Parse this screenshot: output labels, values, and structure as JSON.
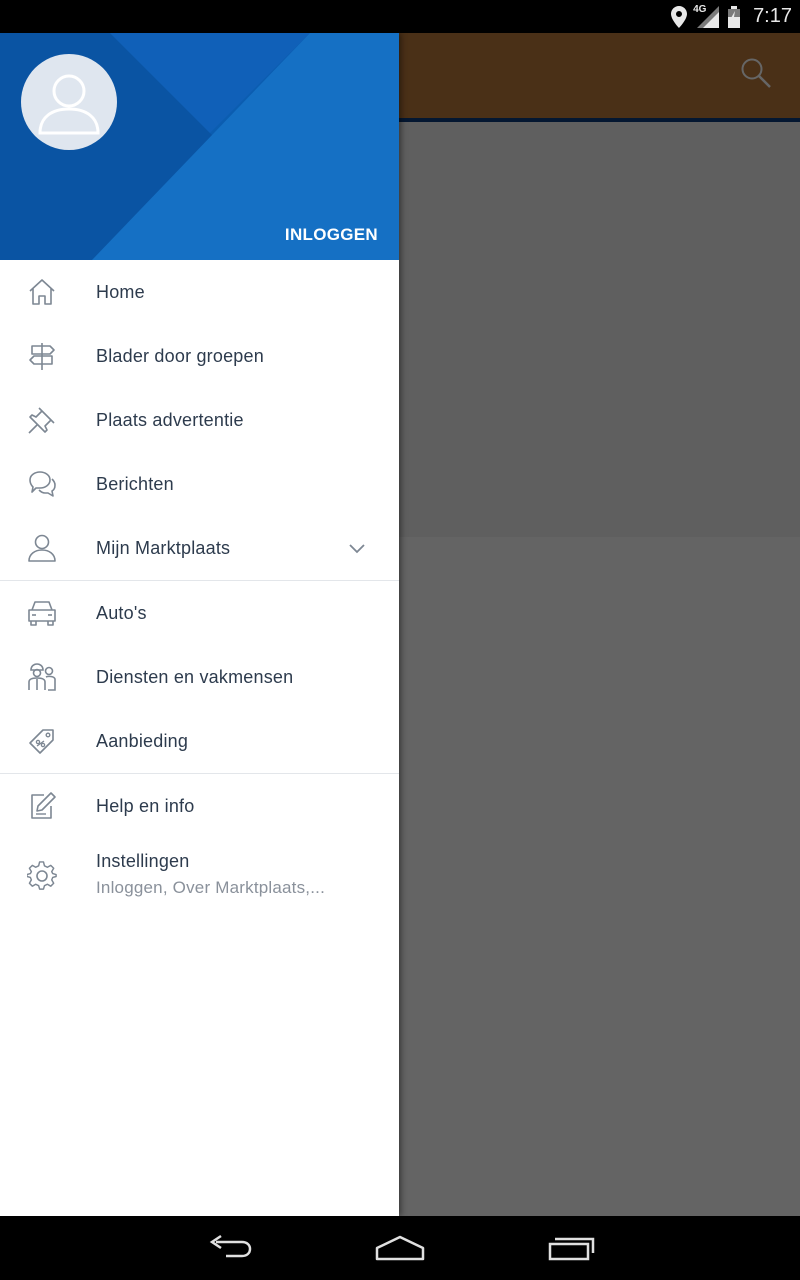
{
  "status_bar": {
    "time": "7:17",
    "network_label": "4G"
  },
  "drawer": {
    "login_label": "INLOGGEN",
    "main_items": [
      {
        "label": "Home",
        "icon": "home-icon"
      },
      {
        "label": "Blader door groepen",
        "icon": "signpost-icon"
      },
      {
        "label": "Plaats advertentie",
        "icon": "pin-icon"
      },
      {
        "label": "Berichten",
        "icon": "chat-icon"
      },
      {
        "label": "Mijn Marktplaats",
        "icon": "user-icon",
        "expandable": true
      }
    ],
    "category_items": [
      {
        "label": "Auto's",
        "icon": "car-icon"
      },
      {
        "label": "Diensten en vakmensen",
        "icon": "workers-icon"
      },
      {
        "label": "Aanbieding",
        "icon": "tag-icon"
      }
    ],
    "help_item": {
      "label": "Help en info",
      "icon": "edit-icon"
    },
    "settings_item": {
      "label": "Instellingen",
      "sublabel": "Inloggen, Over Marktplaats,...",
      "icon": "gear-icon"
    }
  },
  "colors": {
    "header_blue": "#0b5db0",
    "toolbar_brown": "#b9783a",
    "menu_text": "#2d3b4d",
    "sub_text": "#8a919b",
    "icon_gray": "#7d8793"
  }
}
